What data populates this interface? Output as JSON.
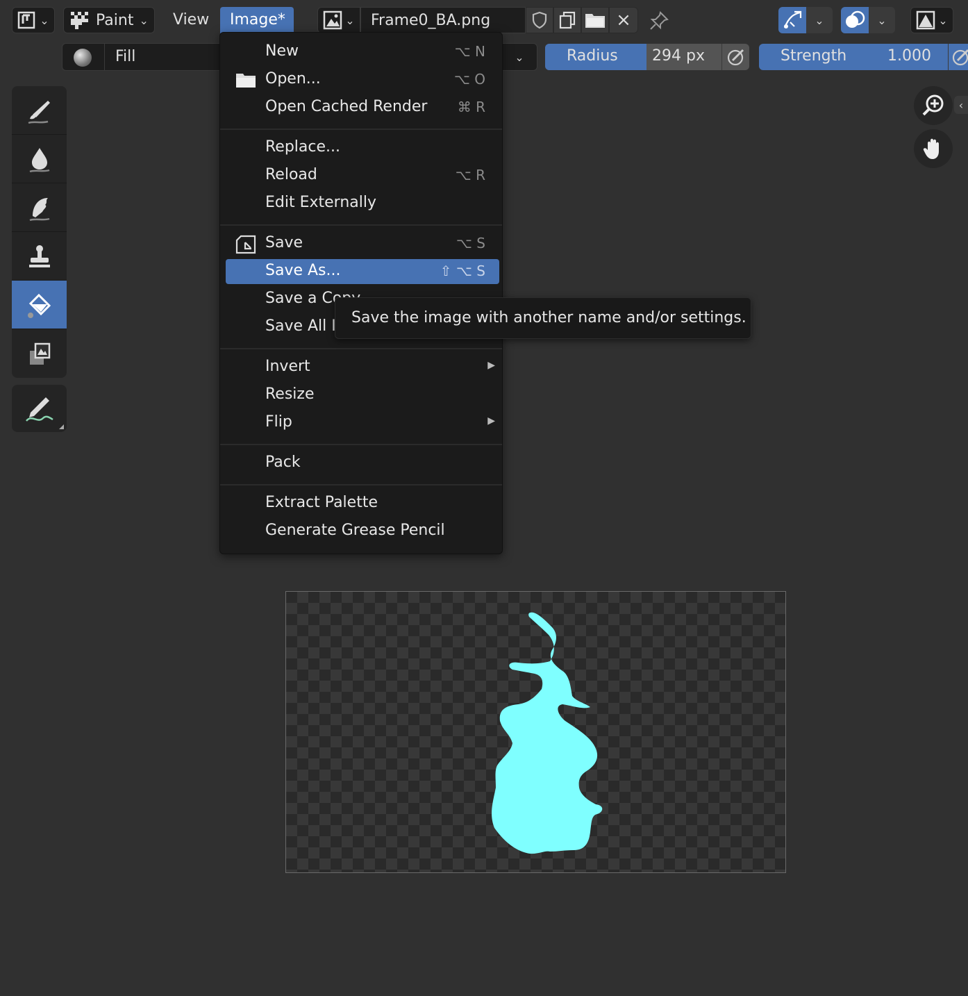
{
  "header": {
    "mode_label": "Paint",
    "view_menu": "View",
    "image_menu": "Image*",
    "image_name": "Frame0_BA.png"
  },
  "toolsettings": {
    "brush_name": "Fill",
    "radius_label": "Radius",
    "radius_value": "294 px",
    "strength_label": "Strength",
    "strength_value": "1.000"
  },
  "menu": {
    "items": [
      {
        "label": "New",
        "shortcut": "⌥ N"
      },
      {
        "label": "Open...",
        "shortcut": "⌥ O"
      },
      {
        "label": "Open Cached Render",
        "shortcut": "⌘ R"
      },
      {
        "label": "Replace...",
        "shortcut": ""
      },
      {
        "label": "Reload",
        "shortcut": "⌥ R"
      },
      {
        "label": "Edit Externally",
        "shortcut": ""
      },
      {
        "label": "Save",
        "shortcut": "⌥ S"
      },
      {
        "label": "Save As...",
        "shortcut": "⇧ ⌥ S"
      },
      {
        "label": "Save a Copy",
        "shortcut": ""
      },
      {
        "label": "Save All I",
        "shortcut": ""
      },
      {
        "label": "Invert",
        "shortcut": ""
      },
      {
        "label": "Resize",
        "shortcut": ""
      },
      {
        "label": "Flip",
        "shortcut": ""
      },
      {
        "label": "Pack",
        "shortcut": ""
      },
      {
        "label": "Extract Palette",
        "shortcut": ""
      },
      {
        "label": "Generate Grease Pencil",
        "shortcut": ""
      }
    ]
  },
  "tooltip": {
    "text": "Save the image with another name and/or settings."
  },
  "colors": {
    "accent": "#4772b3",
    "paint": "#7fffff"
  }
}
